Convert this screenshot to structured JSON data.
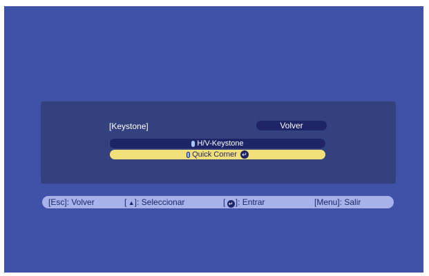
{
  "menu": {
    "title": "[Keystone]",
    "back_label": "Volver",
    "options": [
      {
        "label": "H/V-Keystone",
        "selected": false
      },
      {
        "label": "Quick Corner",
        "selected": true
      }
    ]
  },
  "help_bar": {
    "esc": "[Esc]: Volver",
    "select_prefix": "[",
    "select_suffix": "]: Seleccionar",
    "enter_prefix": "[",
    "enter_suffix": "]: Entrar",
    "menu": "[Menu]: Salir"
  },
  "icons": {
    "up_down": "up-down-arrow-icon",
    "enter": "enter-icon"
  },
  "colors": {
    "background": "#3f52a8",
    "panel": "#33417f",
    "button_dark": "#1d2567",
    "highlight": "#f1e07a",
    "help_bar": "#a7b2ea"
  }
}
